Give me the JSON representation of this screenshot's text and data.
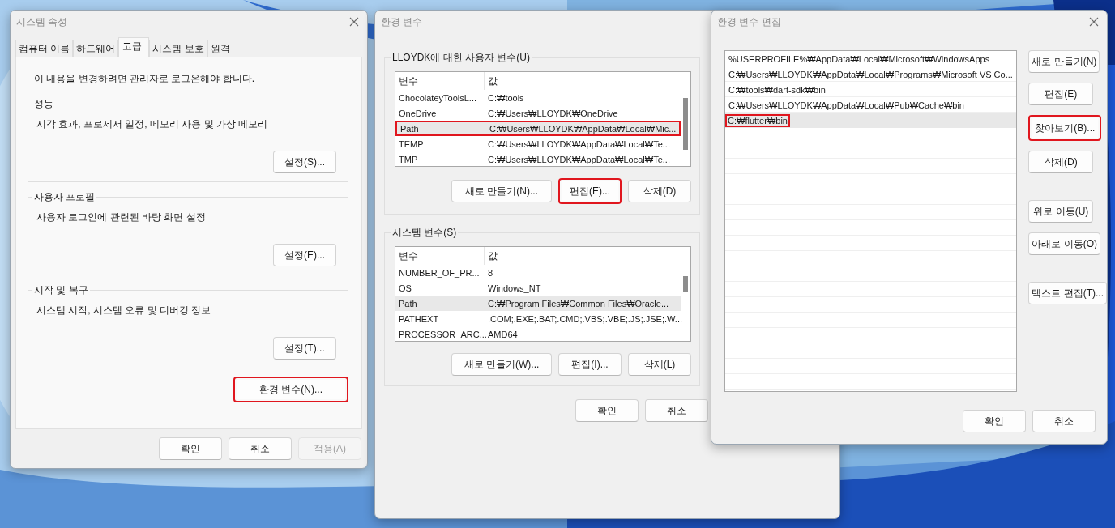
{
  "system_properties": {
    "title": "시스템 속성",
    "tabs": [
      {
        "label": "컴퓨터 이름",
        "selected": false
      },
      {
        "label": "하드웨어",
        "selected": false
      },
      {
        "label": "고급",
        "selected": true
      },
      {
        "label": "시스템 보호",
        "selected": false
      },
      {
        "label": "원격",
        "selected": false
      }
    ],
    "notice": "이 내용을 변경하려면 관리자로 로그온해야 합니다.",
    "groups": [
      {
        "label": "성능",
        "description": "시각 효과, 프로세서 일정, 메모리 사용 및 가상 메모리",
        "button": {
          "label": "설정(S)...",
          "highlighted": false
        }
      },
      {
        "label": "사용자 프로필",
        "description": "사용자 로그인에 관련된 바탕 화면 설정",
        "button": {
          "label": "설정(E)...",
          "highlighted": false
        }
      },
      {
        "label": "시작 및 복구",
        "description": "시스템 시작, 시스템 오류 및 디버깅 정보",
        "button": {
          "label": "설정(T)...",
          "highlighted": false
        }
      }
    ],
    "env_button": {
      "label": "환경 변수(N)...",
      "highlighted": true
    },
    "buttons": [
      {
        "label": "확인",
        "disabled": false
      },
      {
        "label": "취소",
        "disabled": false
      },
      {
        "label": "적용(A)",
        "disabled": true
      }
    ]
  },
  "environment_variables": {
    "title": "환경 변수",
    "sections": [
      {
        "label": "LLOYDK에 대한 사용자 변수(U)",
        "columns": [
          "변수",
          "값"
        ],
        "rows": [
          {
            "name": "ChocolateyToolsL...",
            "value": "C:₩tools",
            "selected": false,
            "highlighted": false
          },
          {
            "name": "OneDrive",
            "value": "C:₩Users₩LLOYDK₩OneDrive",
            "selected": false,
            "highlighted": false
          },
          {
            "name": "Path",
            "value": "C:₩Users₩LLOYDK₩AppData₩Local₩Mic...",
            "selected": true,
            "highlighted": true
          },
          {
            "name": "TEMP",
            "value": "C:₩Users₩LLOYDK₩AppData₩Local₩Te...",
            "selected": false,
            "highlighted": false
          },
          {
            "name": "TMP",
            "value": "C:₩Users₩LLOYDK₩AppData₩Local₩Te...",
            "selected": false,
            "highlighted": false
          }
        ],
        "buttons": [
          {
            "label": "새로 만들기(N)...",
            "highlighted": false
          },
          {
            "label": "편집(E)...",
            "highlighted": true
          },
          {
            "label": "삭제(D)",
            "highlighted": false
          }
        ]
      },
      {
        "label": "시스템 변수(S)",
        "columns": [
          "변수",
          "값"
        ],
        "rows": [
          {
            "name": "NUMBER_OF_PR...",
            "value": "8",
            "selected": false,
            "highlighted": false
          },
          {
            "name": "OS",
            "value": "Windows_NT",
            "selected": false,
            "highlighted": false
          },
          {
            "name": "Path",
            "value": "C:₩Program Files₩Common Files₩Oracle...",
            "selected": true,
            "highlighted": false
          },
          {
            "name": "PATHEXT",
            "value": ".COM;.EXE;.BAT;.CMD;.VBS;.VBE;.JS;.JSE;.W...",
            "selected": false,
            "highlighted": false
          },
          {
            "name": "PROCESSOR_ARC...",
            "value": "AMD64",
            "selected": false,
            "highlighted": false
          }
        ],
        "buttons": [
          {
            "label": "새로 만들기(W)...",
            "highlighted": false
          },
          {
            "label": "편집(I)...",
            "highlighted": false
          },
          {
            "label": "삭제(L)",
            "highlighted": false
          }
        ]
      }
    ],
    "buttons": [
      {
        "label": "확인",
        "disabled": false
      },
      {
        "label": "취소",
        "disabled": false
      }
    ]
  },
  "edit_environment_variable": {
    "title": "환경 변수 편집",
    "entries": [
      {
        "text": "%USERPROFILE%₩AppData₩Local₩Microsoft₩WindowsApps",
        "selected": false,
        "highlighted": false
      },
      {
        "text": "C:₩Users₩LLOYDK₩AppData₩Local₩Programs₩Microsoft VS Co...",
        "selected": false,
        "highlighted": false
      },
      {
        "text": "C:₩tools₩dart-sdk₩bin",
        "selected": false,
        "highlighted": false
      },
      {
        "text": "C:₩Users₩LLOYDK₩AppData₩Local₩Pub₩Cache₩bin",
        "selected": false,
        "highlighted": false
      },
      {
        "text": "C:₩flutter₩bin",
        "selected": true,
        "highlighted": true
      }
    ],
    "side_buttons": [
      [
        {
          "label": "새로 만들기(N)",
          "highlighted": false
        },
        {
          "label": "편집(E)",
          "highlighted": false
        },
        {
          "label": "찾아보기(B)...",
          "highlighted": true
        },
        {
          "label": "삭제(D)",
          "highlighted": false
        }
      ],
      [
        {
          "label": "위로 이동(U)",
          "highlighted": false
        },
        {
          "label": "아래로 이동(O)",
          "highlighted": false
        }
      ],
      [
        {
          "label": "텍스트 편집(T)...",
          "highlighted": false
        }
      ]
    ],
    "buttons": [
      {
        "label": "확인",
        "disabled": false
      },
      {
        "label": "취소",
        "disabled": false
      }
    ]
  }
}
